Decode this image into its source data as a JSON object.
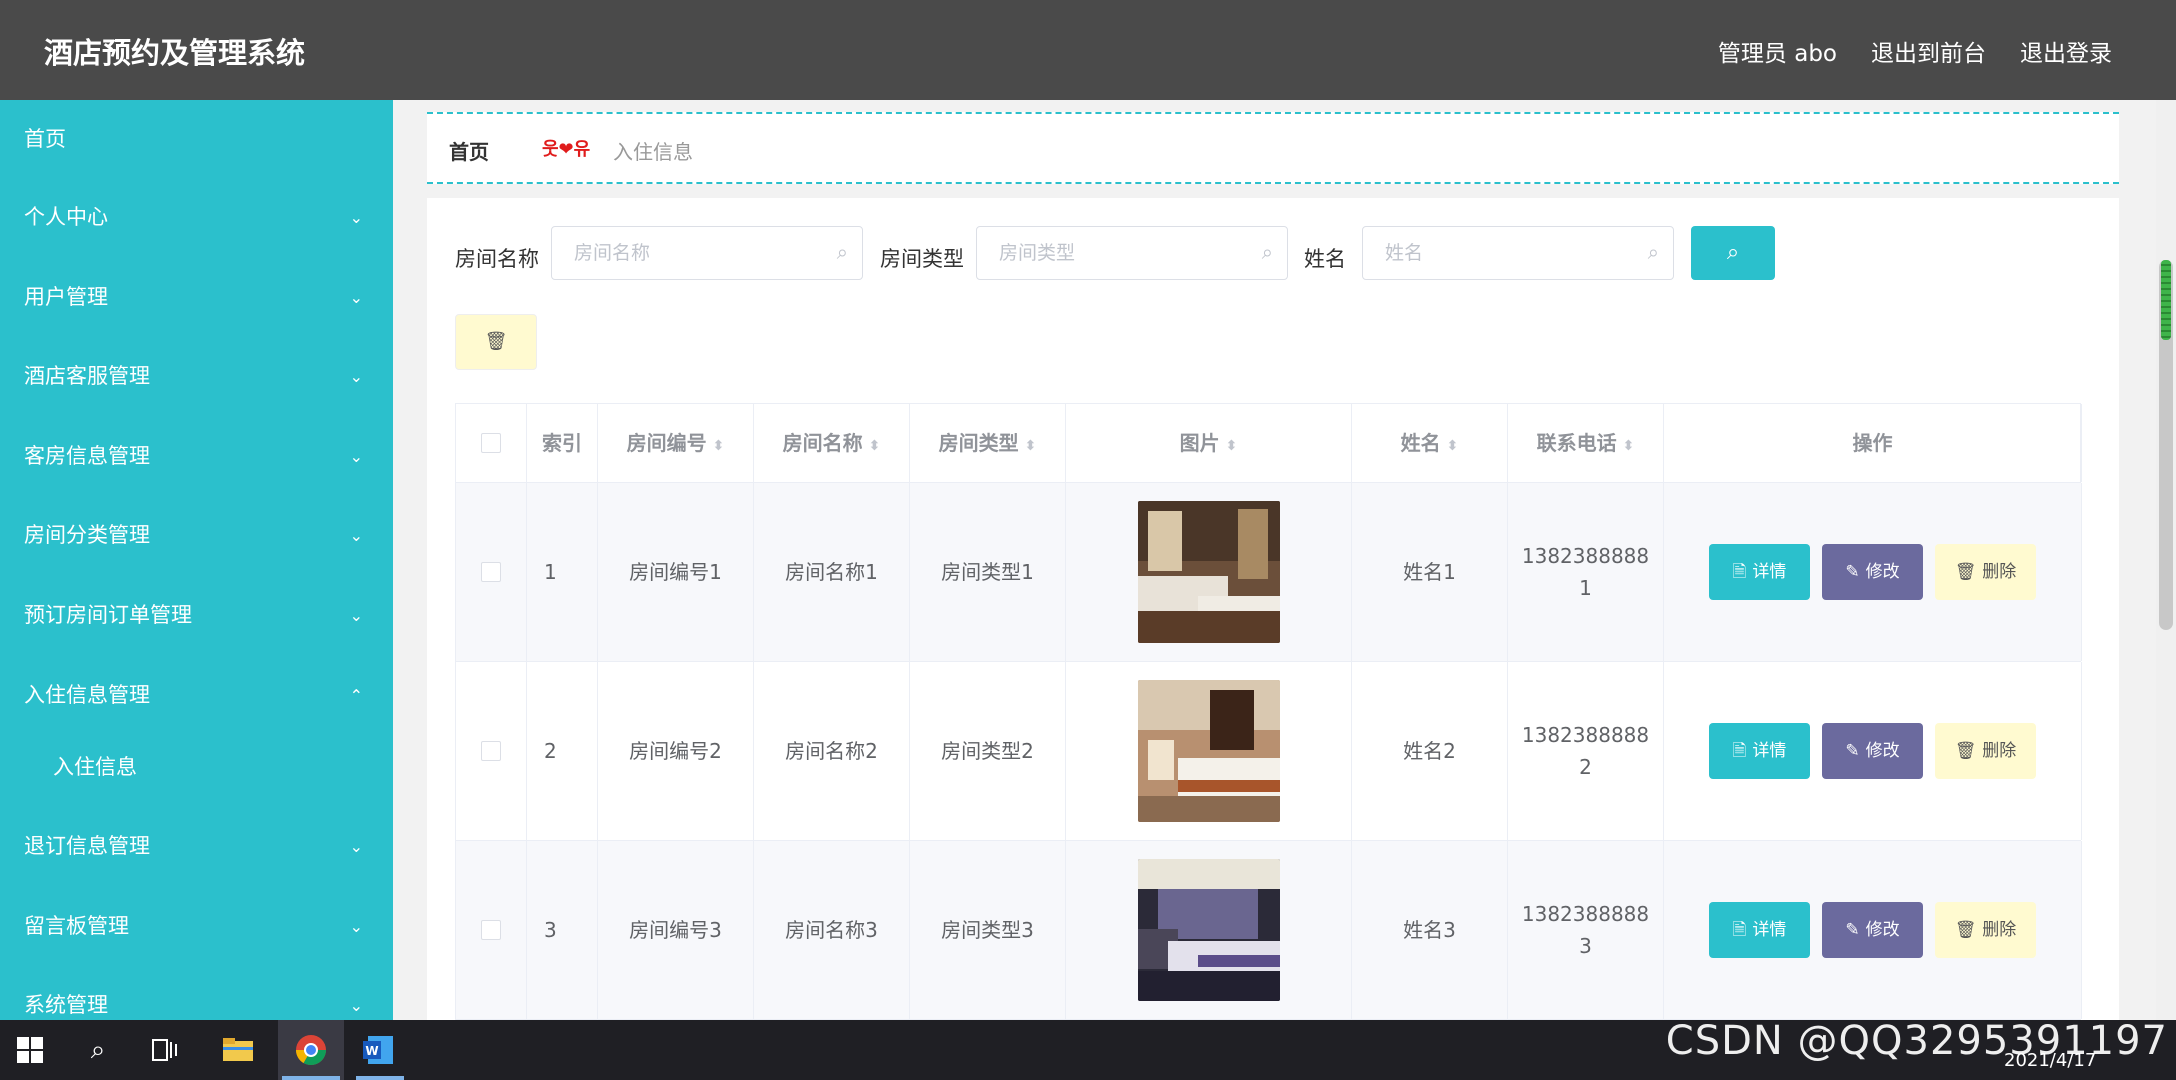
{
  "app": {
    "title": "酒店预约及管理系统"
  },
  "header": {
    "links": [
      "管理员 abo",
      "退出到前台",
      "退出登录"
    ]
  },
  "sidebar": {
    "items": [
      {
        "label": "首页",
        "chevron": ""
      },
      {
        "label": "个人中心",
        "chevron": "⌄"
      },
      {
        "label": "用户管理",
        "chevron": "⌄"
      },
      {
        "label": "酒店客服管理",
        "chevron": "⌄"
      },
      {
        "label": "客房信息管理",
        "chevron": "⌄"
      },
      {
        "label": "房间分类管理",
        "chevron": "⌄"
      },
      {
        "label": "预订房间订单管理",
        "chevron": "⌄"
      },
      {
        "label": "入住信息管理",
        "chevron": "⌃"
      }
    ],
    "subitem": "入住信息",
    "items2": [
      {
        "label": "退订信息管理",
        "chevron": "⌄"
      },
      {
        "label": "留言板管理",
        "chevron": "⌄"
      },
      {
        "label": "系统管理",
        "chevron": "⌄"
      }
    ]
  },
  "breadcrumb": {
    "home": "首页",
    "separator": "웃❤유",
    "current": "入住信息"
  },
  "search": {
    "fields": [
      {
        "label": "房间名称",
        "placeholder": "房间名称"
      },
      {
        "label": "房间类型",
        "placeholder": "房间类型"
      },
      {
        "label": "姓名",
        "placeholder": "姓名"
      }
    ],
    "button_icon": "search-icon"
  },
  "table": {
    "headers": [
      "索引",
      "房间编号",
      "房间名称",
      "房间类型",
      "图片",
      "姓名",
      "联系电话",
      "操作"
    ],
    "rows": [
      {
        "index": "1",
        "room_no": "房间编号1",
        "room_name": "房间名称1",
        "room_type": "房间类型1",
        "name": "姓名1",
        "phone_a": "1382388888",
        "phone_b": "1"
      },
      {
        "index": "2",
        "room_no": "房间编号2",
        "room_name": "房间名称2",
        "room_type": "房间类型2",
        "name": "姓名2",
        "phone_a": "1382388888",
        "phone_b": "2"
      },
      {
        "index": "3",
        "room_no": "房间编号3",
        "room_name": "房间名称3",
        "room_type": "房间类型3",
        "name": "姓名3",
        "phone_a": "1382388888",
        "phone_b": "3"
      }
    ],
    "actions": {
      "detail": "详情",
      "edit": "修改",
      "delete": "删除"
    }
  },
  "taskbar": {
    "date": "2021/4/17",
    "watermark": "CSDN @QQ3295391197"
  },
  "colors": {
    "accent": "#2bc0cc",
    "header": "#4a4a4a",
    "edit": "#6b6a9e",
    "delete": "#fffad0"
  }
}
